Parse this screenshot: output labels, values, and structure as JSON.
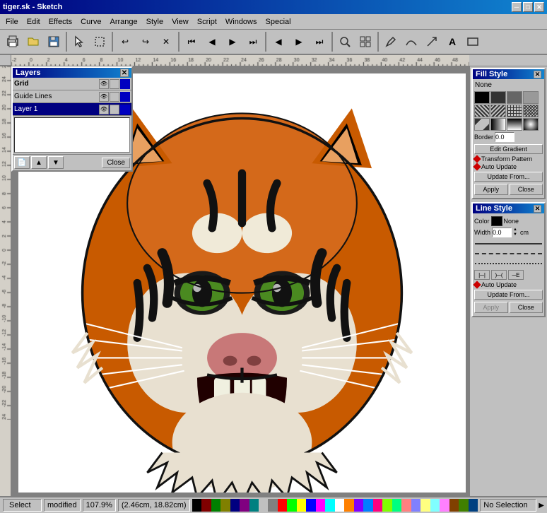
{
  "app": {
    "title": "tiger.sk - Sketch",
    "close_btn": "✕",
    "minimize_btn": "─",
    "maximize_btn": "□"
  },
  "menu": {
    "items": [
      "File",
      "Edit",
      "Effects",
      "Curve",
      "Arrange",
      "Style",
      "View",
      "Script",
      "Windows",
      "Special"
    ]
  },
  "toolbar": {
    "tools": [
      "🖨",
      "📂",
      "💾",
      "🖊",
      "↩",
      "↪",
      "✕",
      "⏮",
      "◀",
      "▶",
      "⏭",
      "◀",
      "▶",
      "⏭",
      "◀",
      "▶",
      "⏭",
      "◀",
      "▶",
      "🔍",
      "▦",
      "▣",
      "✏",
      "⌒",
      "↗",
      "A",
      "▬"
    ]
  },
  "layers": {
    "title": "Layers",
    "close": "✕",
    "items": [
      {
        "name": "Grid",
        "visible": true,
        "locked": false
      },
      {
        "name": "Guide Lines",
        "visible": true,
        "locked": false
      },
      {
        "name": "Layer 1",
        "visible": true,
        "locked": false
      }
    ],
    "toolbar_btns": [
      "📄",
      "▲",
      "▼"
    ],
    "close_btn": "Close"
  },
  "fill_style": {
    "title": "Fill Style",
    "close": "✕",
    "none_label": "None",
    "swatches": [
      "#000000",
      "#333333",
      "#666666",
      "#999999",
      "#cccccc",
      "#ffffff",
      "diagonal1",
      "diagonal2",
      "cross1",
      "cross2",
      "crosshatch",
      "gradient1",
      "gradient2",
      "gradient3",
      "gradient4",
      "pattern1"
    ],
    "border_label": "Border",
    "border_value": "0.0",
    "edit_gradient_btn": "Edit Gradient",
    "transform_pattern_label": "Transform Pattern",
    "auto_update_label": "Auto Update",
    "update_from_btn": "Update From...",
    "apply_btn": "Apply",
    "close_btn": "Close"
  },
  "line_style": {
    "title": "Line Style",
    "close": "✕",
    "color_label": "Color",
    "color_value": "None",
    "width_label": "Width",
    "width_value": "0.0",
    "width_unit": "cm",
    "auto_update_label": "Auto Update",
    "update_from_btn": "Update From...",
    "apply_btn": "Apply",
    "close_btn": "Close"
  },
  "status": {
    "tool": "Select",
    "mode": "modified",
    "zoom": "107.9%",
    "position": "(2.46cm, 18.82cm)",
    "selection": "No Selection"
  },
  "palette_colors": [
    "#000000",
    "#800000",
    "#008000",
    "#808000",
    "#000080",
    "#800080",
    "#008080",
    "#c0c0c0",
    "#808080",
    "#ff0000",
    "#00ff00",
    "#ffff00",
    "#0000ff",
    "#ff00ff",
    "#00ffff",
    "#ffffff",
    "#ff8000",
    "#8000ff",
    "#0080ff",
    "#ff0080",
    "#80ff00",
    "#00ff80",
    "#ff8080",
    "#8080ff",
    "#ffff80",
    "#80ffff",
    "#ff80ff",
    "#804000",
    "#408000",
    "#004080"
  ]
}
